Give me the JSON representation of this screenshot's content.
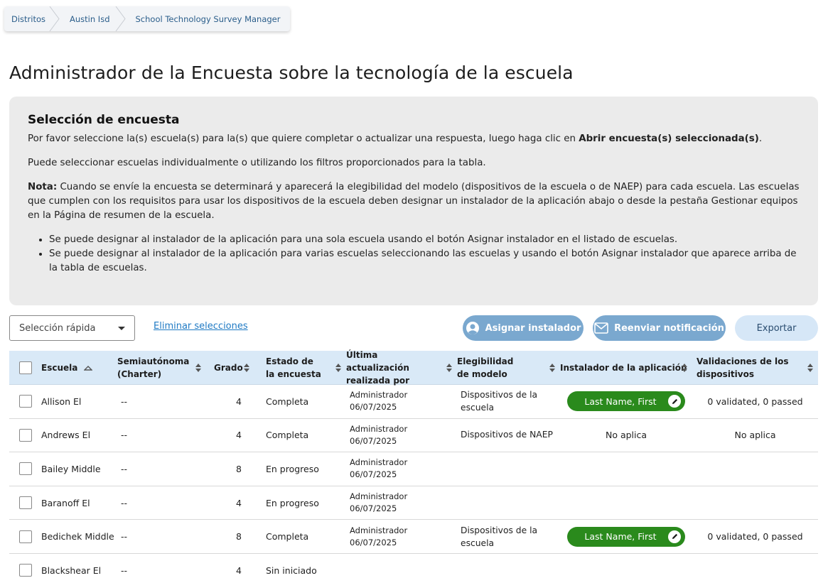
{
  "breadcrumb": {
    "items": [
      "Distritos",
      "Austin Isd",
      "School Technology Survey Manager"
    ]
  },
  "page": {
    "title": "Administrador de la Encuesta sobre la tecnología de la escuela"
  },
  "panel": {
    "heading": "Selección de encuesta",
    "p1_prefix": "Por favor seleccione la(s) escuela(s) para la(s) que quiere completar o actualizar una respuesta, luego haga clic en ",
    "p1_bold": "Abrir encuesta(s) seleccionada(s)",
    "p1_suffix": ".",
    "p2": "Puede seleccionar escuelas individualmente o utilizando los filtros proporcionados para la tabla.",
    "p3_bold": "Nota:",
    "p3": " Cuando se envíe la encuesta se determinará y aparecerá la elegibilidad del modelo (dispositivos de la escuela o de NAEP) para cada escuela. Las escuelas que cumplen con los requisitos para usar los dispositivos de la escuela deben designar un instalador de la aplicación abajo o desde la pestaña Gestionar equipos en la Página de resumen de la escuela.",
    "bullets": [
      "Se puede designar al instalador de la aplicación para una sola escuela usando el botón Asignar instalador en el listado de escuelas.",
      "Se puede designar al instalador de la aplicación para varias escuelas seleccionando las escuelas y usando el botón Asignar instalador que aparece arriba de la tabla de escuelas."
    ]
  },
  "toolbar": {
    "quick_select": "Selección rápida",
    "clear_link": "Eliminar selecciones",
    "assign_label": "Asignar instalador",
    "resend_label": "Reenviar notificación",
    "export_label": "Exportar"
  },
  "table": {
    "headers": {
      "school": "Escuela",
      "charter": "Semiautónoma (Charter)",
      "grade": "Grado",
      "status": "Estado de la encuesta",
      "updated": "Última actualización realizada por",
      "eligibility": "Elegibilidad de modelo",
      "installer": "Instalador de la aplicación",
      "validations": "Validaciones de los dispositivos"
    },
    "rows": [
      {
        "school": "Allison El",
        "charter": "--",
        "grade": "4",
        "status": "Completa",
        "updated_by": "Administrador",
        "updated_date": "06/07/2025",
        "eligibility": "Dispositivos de la escuela",
        "installer": "Last Name, First",
        "validations": "0 validated, 0 passed"
      },
      {
        "school": "Andrews El",
        "charter": "--",
        "grade": "4",
        "status": "Completa",
        "updated_by": "Administrador",
        "updated_date": "06/07/2025",
        "eligibility": "Dispositivos de NAEP",
        "installer": "No aplica",
        "validations": "No aplica"
      },
      {
        "school": "Bailey Middle",
        "charter": "--",
        "grade": "8",
        "status": "En progreso",
        "updated_by": "Administrador",
        "updated_date": "06/07/2025",
        "eligibility": "",
        "installer": "",
        "validations": ""
      },
      {
        "school": "Baranoff El",
        "charter": "--",
        "grade": "4",
        "status": "En progreso",
        "updated_by": "Administrador",
        "updated_date": "06/07/2025",
        "eligibility": "",
        "installer": "",
        "validations": ""
      },
      {
        "school": "Bedichek Middle",
        "charter": "--",
        "grade": "8",
        "status": "Completa",
        "updated_by": "Administrador",
        "updated_date": "06/07/2025",
        "eligibility": "Dispositivos de la escuela",
        "installer": "Last Name, First",
        "validations": "0 validated, 0 passed"
      },
      {
        "school": "Blackshear El",
        "charter": "--",
        "grade": "4",
        "status": "Sin iniciado",
        "updated_by": "",
        "updated_date": "",
        "eligibility": "",
        "installer": "",
        "validations": ""
      }
    ]
  },
  "colors": {
    "header_bg": "#d9e9f7",
    "panel_bg": "#ebebeb",
    "button_blue": "#7aa8cf",
    "installer_green": "#2a8a1c",
    "link_blue": "#1f7ac4"
  }
}
